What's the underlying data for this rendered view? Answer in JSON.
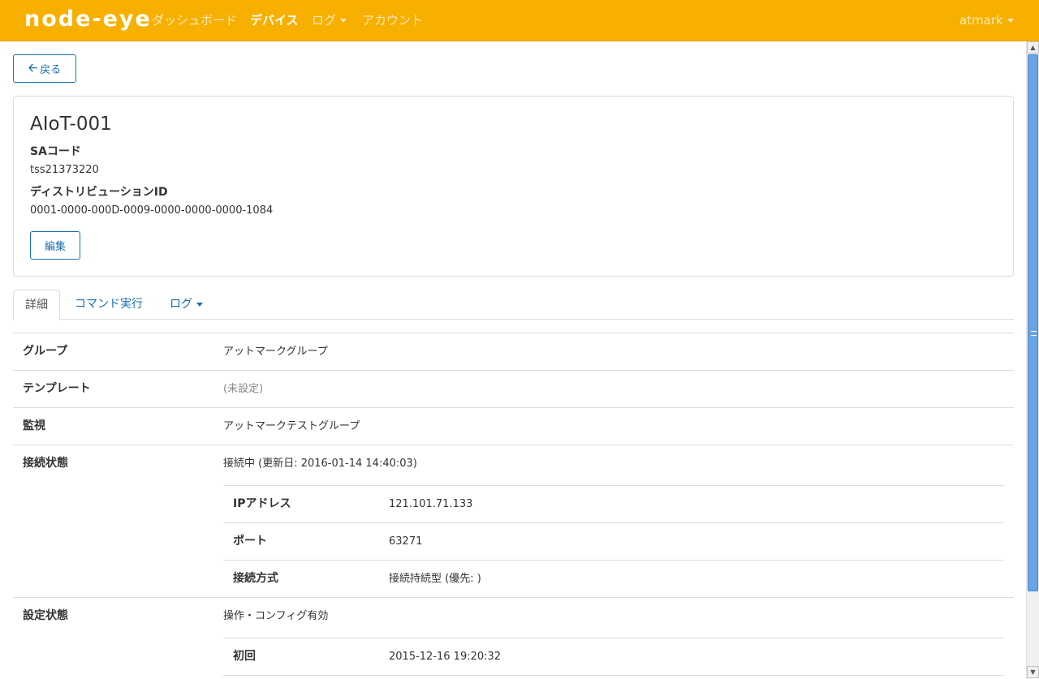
{
  "nav": {
    "brand": "node-eye",
    "items": [
      {
        "label": "ダッシュボード"
      },
      {
        "label": "デバイス"
      },
      {
        "label": "ログ"
      },
      {
        "label": "アカウント"
      }
    ],
    "user": "atmark"
  },
  "back_button": "戻る",
  "device": {
    "name": "AIoT-001",
    "sa_code_label": "SAコード",
    "sa_code": "tss21373220",
    "distribution_label": "ディストリビューションID",
    "distribution_id": "0001-0000-000D-0009-0000-0000-0000-1084",
    "edit_button": "編集"
  },
  "tabs": [
    {
      "label": "詳細"
    },
    {
      "label": "コマンド実行"
    },
    {
      "label": "ログ"
    }
  ],
  "details": {
    "group_label": "グループ",
    "group_value": "アットマークグループ",
    "template_label": "テンプレート",
    "template_value": "(未設定)",
    "monitor_label": "監視",
    "monitor_value": "アットマークテストグループ",
    "connection_label": "接続状態",
    "connection_value": "接続中 (更新日: 2016-01-14 14:40:03)",
    "connection_rows": [
      {
        "label": "IPアドレス",
        "value": "121.101.71.133"
      },
      {
        "label": "ポート",
        "value": "63271"
      },
      {
        "label": "接続方式",
        "value": "接続持続型 (優先: )"
      }
    ],
    "config_label": "設定状態",
    "config_value": "操作・コンフィグ有効",
    "config_rows": [
      {
        "label": "初回",
        "value": "2015-12-16 19:20:32"
      }
    ]
  }
}
